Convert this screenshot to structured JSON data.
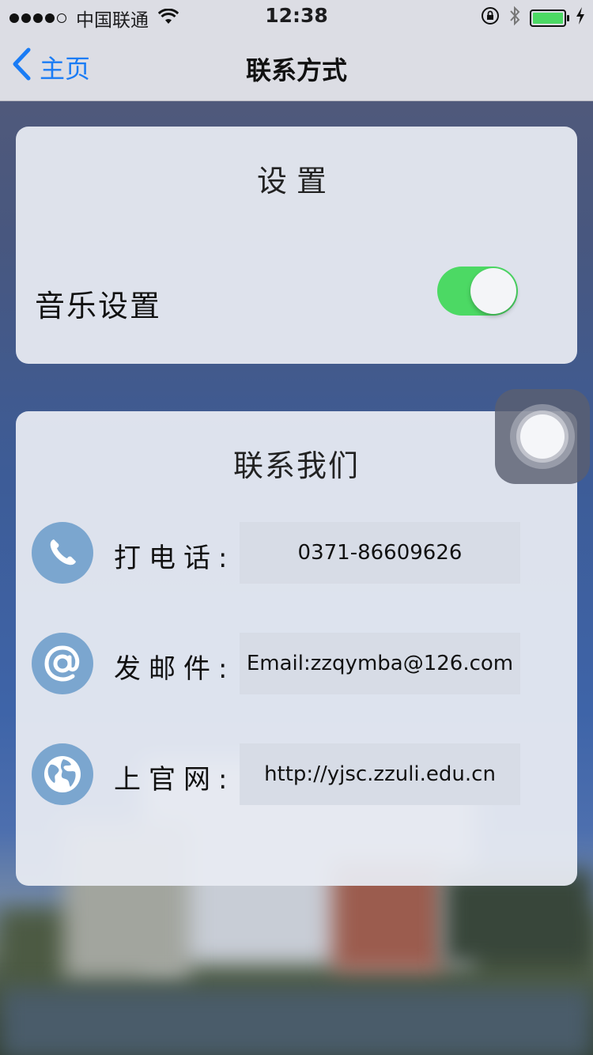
{
  "status_bar": {
    "signal_filled": 4,
    "signal_total": 5,
    "carrier": "中国联通",
    "time": "12:38",
    "icons": [
      "wifi-icon",
      "orientation-lock-icon",
      "bluetooth-icon",
      "battery-icon",
      "charging-icon"
    ],
    "battery_level": 1.0
  },
  "nav": {
    "back_label": "主页",
    "title": "联系方式"
  },
  "settings": {
    "title": "设置",
    "music_label": "音乐设置",
    "music_enabled": true
  },
  "contact": {
    "title": "联系我们",
    "rows": [
      {
        "icon": "phone-icon",
        "label": "打电话:",
        "value": "0371-86609626"
      },
      {
        "icon": "at-sign-icon",
        "label": "发邮件:",
        "value": "Email:zzqymba@126.com"
      },
      {
        "icon": "globe-icon",
        "label": "上官网:",
        "value": "http://yjsc.zzuli.edu.cn"
      }
    ]
  },
  "colors": {
    "accent_blue": "#1a7cf5",
    "toggle_on": "#4cd964",
    "icon_circle": "#7ba6cf",
    "battery_fill": "#4cd964"
  }
}
